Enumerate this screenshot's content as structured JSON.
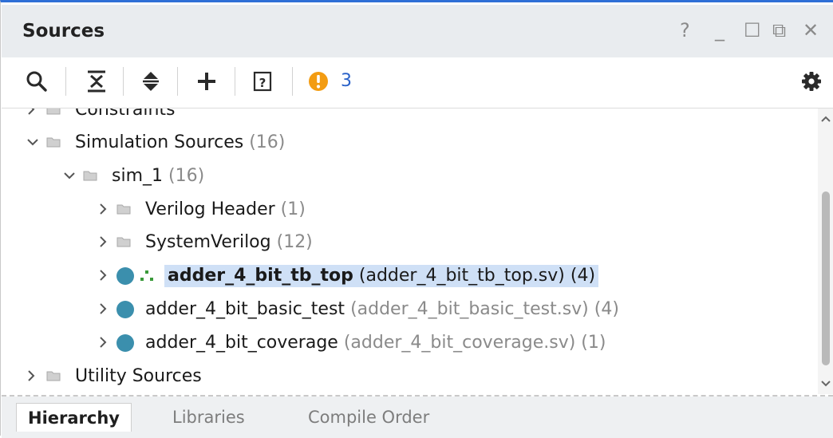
{
  "window": {
    "title": "Sources",
    "help_glyph": "?",
    "minimize_glyph": "_",
    "maximize_glyph": "☐",
    "float_glyph": "⧉",
    "close_glyph": "✕"
  },
  "toolbar": {
    "icons": [
      "search-icon",
      "collapse-all-icon",
      "expand-all-icon",
      "add-icon",
      "help-icon",
      "warning-icon",
      "gear-icon"
    ],
    "warning_count": "3",
    "accent": "#f39c12"
  },
  "tree": {
    "constraints": {
      "label": "Constraints"
    },
    "simulation_sources": {
      "label": "Simulation Sources",
      "count": "(16)"
    },
    "sim_1": {
      "label": "sim_1",
      "count": "(16)"
    },
    "verilog_header": {
      "label": "Verilog Header",
      "count": "(1)"
    },
    "systemverilog": {
      "label": "SystemVerilog",
      "count": "(12)"
    },
    "tb_top": {
      "label": "adder_4_bit_tb_top",
      "file": "(adder_4_bit_tb_top.sv)",
      "count": "(4)"
    },
    "basic_test": {
      "label": "adder_4_bit_basic_test",
      "file": "(adder_4_bit_basic_test.sv)",
      "count": "(4)"
    },
    "coverage": {
      "label": "adder_4_bit_coverage",
      "file": "(adder_4_bit_coverage.sv)",
      "count": "(1)"
    },
    "utility_sources": {
      "label": "Utility Sources"
    }
  },
  "tabs": [
    {
      "label": "Hierarchy",
      "active": true
    },
    {
      "label": "Libraries",
      "active": false
    },
    {
      "label": "Compile Order",
      "active": false
    }
  ],
  "colors": {
    "module_dot": "#3b8fad",
    "selection": "#cfe0f6",
    "window_accent": "#2f6fd6"
  }
}
